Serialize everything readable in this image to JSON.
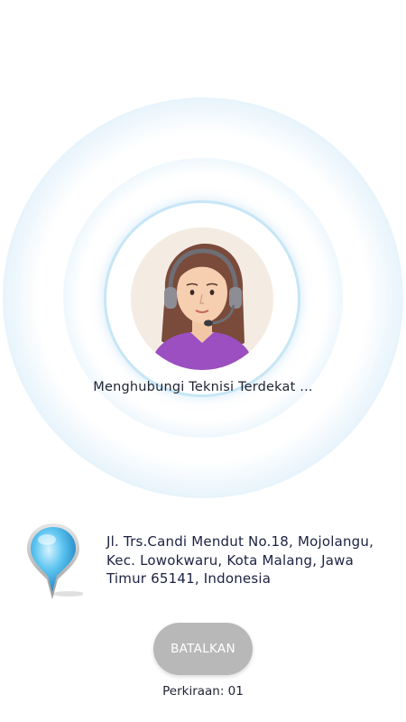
{
  "search": {
    "status_text": "Menghubungi Teknisi Terdekat ...",
    "avatar_icon": "customer-service-agent-icon"
  },
  "location": {
    "pin_icon": "map-pin-icon",
    "address": "Jl. Trs.Candi Mendut No.18, Mojolangu, Kec. Lowokwaru, Kota Malang, Jawa Timur 65141, Indonesia"
  },
  "actions": {
    "cancel_label": "BATALKAN"
  },
  "estimate": {
    "text": "Perkiraan: 01"
  },
  "colors": {
    "ripple": "#cfe8f8",
    "ring": "#c7e6f6",
    "button": "#b8b8b8",
    "text": "#1b2142",
    "shirt": "#9b4fc0"
  }
}
